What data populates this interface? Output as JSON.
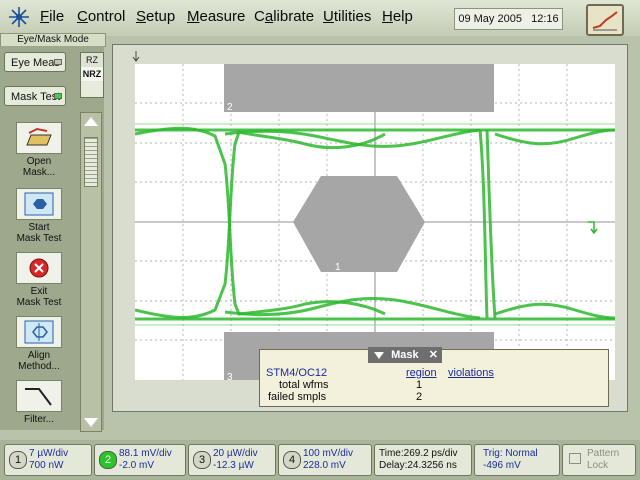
{
  "menubar": {
    "items": [
      "File",
      "Control",
      "Setup",
      "Measure",
      "Calibrate",
      "Utilities",
      "Help"
    ],
    "underline": [
      "F",
      "C",
      "S",
      "M",
      "a",
      "U",
      "H"
    ],
    "date": "09 May 2005",
    "time": "12:16"
  },
  "mode_label": "Eye/Mask Mode",
  "side": {
    "eye_meas": "Eye Meas",
    "mask_test": "Mask Test",
    "rz": "RZ",
    "nrz": "NRZ"
  },
  "tools": [
    {
      "label1": "Open",
      "label2": "Mask..."
    },
    {
      "label1": "Start",
      "label2": "Mask Test"
    },
    {
      "label1": "Exit",
      "label2": "Mask Test"
    },
    {
      "label1": "Align",
      "label2": "Method..."
    },
    {
      "label1": "Filter...",
      "label2": ""
    }
  ],
  "mask_regions": {
    "r1": "1",
    "r2": "2",
    "r3": "3"
  },
  "mask_panel": {
    "title": "Mask",
    "standard": "STM4/OC12",
    "col_region": "region",
    "col_violations": "violations",
    "rows": [
      {
        "label": "total wfms",
        "value": "1"
      },
      {
        "label": "failed smpls",
        "value": "2"
      }
    ]
  },
  "channels": [
    {
      "num": "1",
      "line1": "7 µW/div",
      "line2": "700 nW"
    },
    {
      "num": "2",
      "line1": "88.1 mV/div",
      "line2": "-2.0 mV"
    },
    {
      "num": "3",
      "line1": "20 µW/div",
      "line2": "-12.3 µW"
    },
    {
      "num": "4",
      "line1": "100 mV/div",
      "line2": "228.0 mV"
    }
  ],
  "timebase": {
    "line1": "Time:269.2 ps/div",
    "line2": "Delay:24.3256 ns"
  },
  "trigger": {
    "line1": "Trig: Normal",
    "line2": "-496 mV"
  },
  "pattern": {
    "line1": "Pattern",
    "line2": "Lock"
  },
  "colors": {
    "trace": "#2db82d",
    "mask": "#a6a6a6",
    "active_channel": "#29c62a"
  }
}
